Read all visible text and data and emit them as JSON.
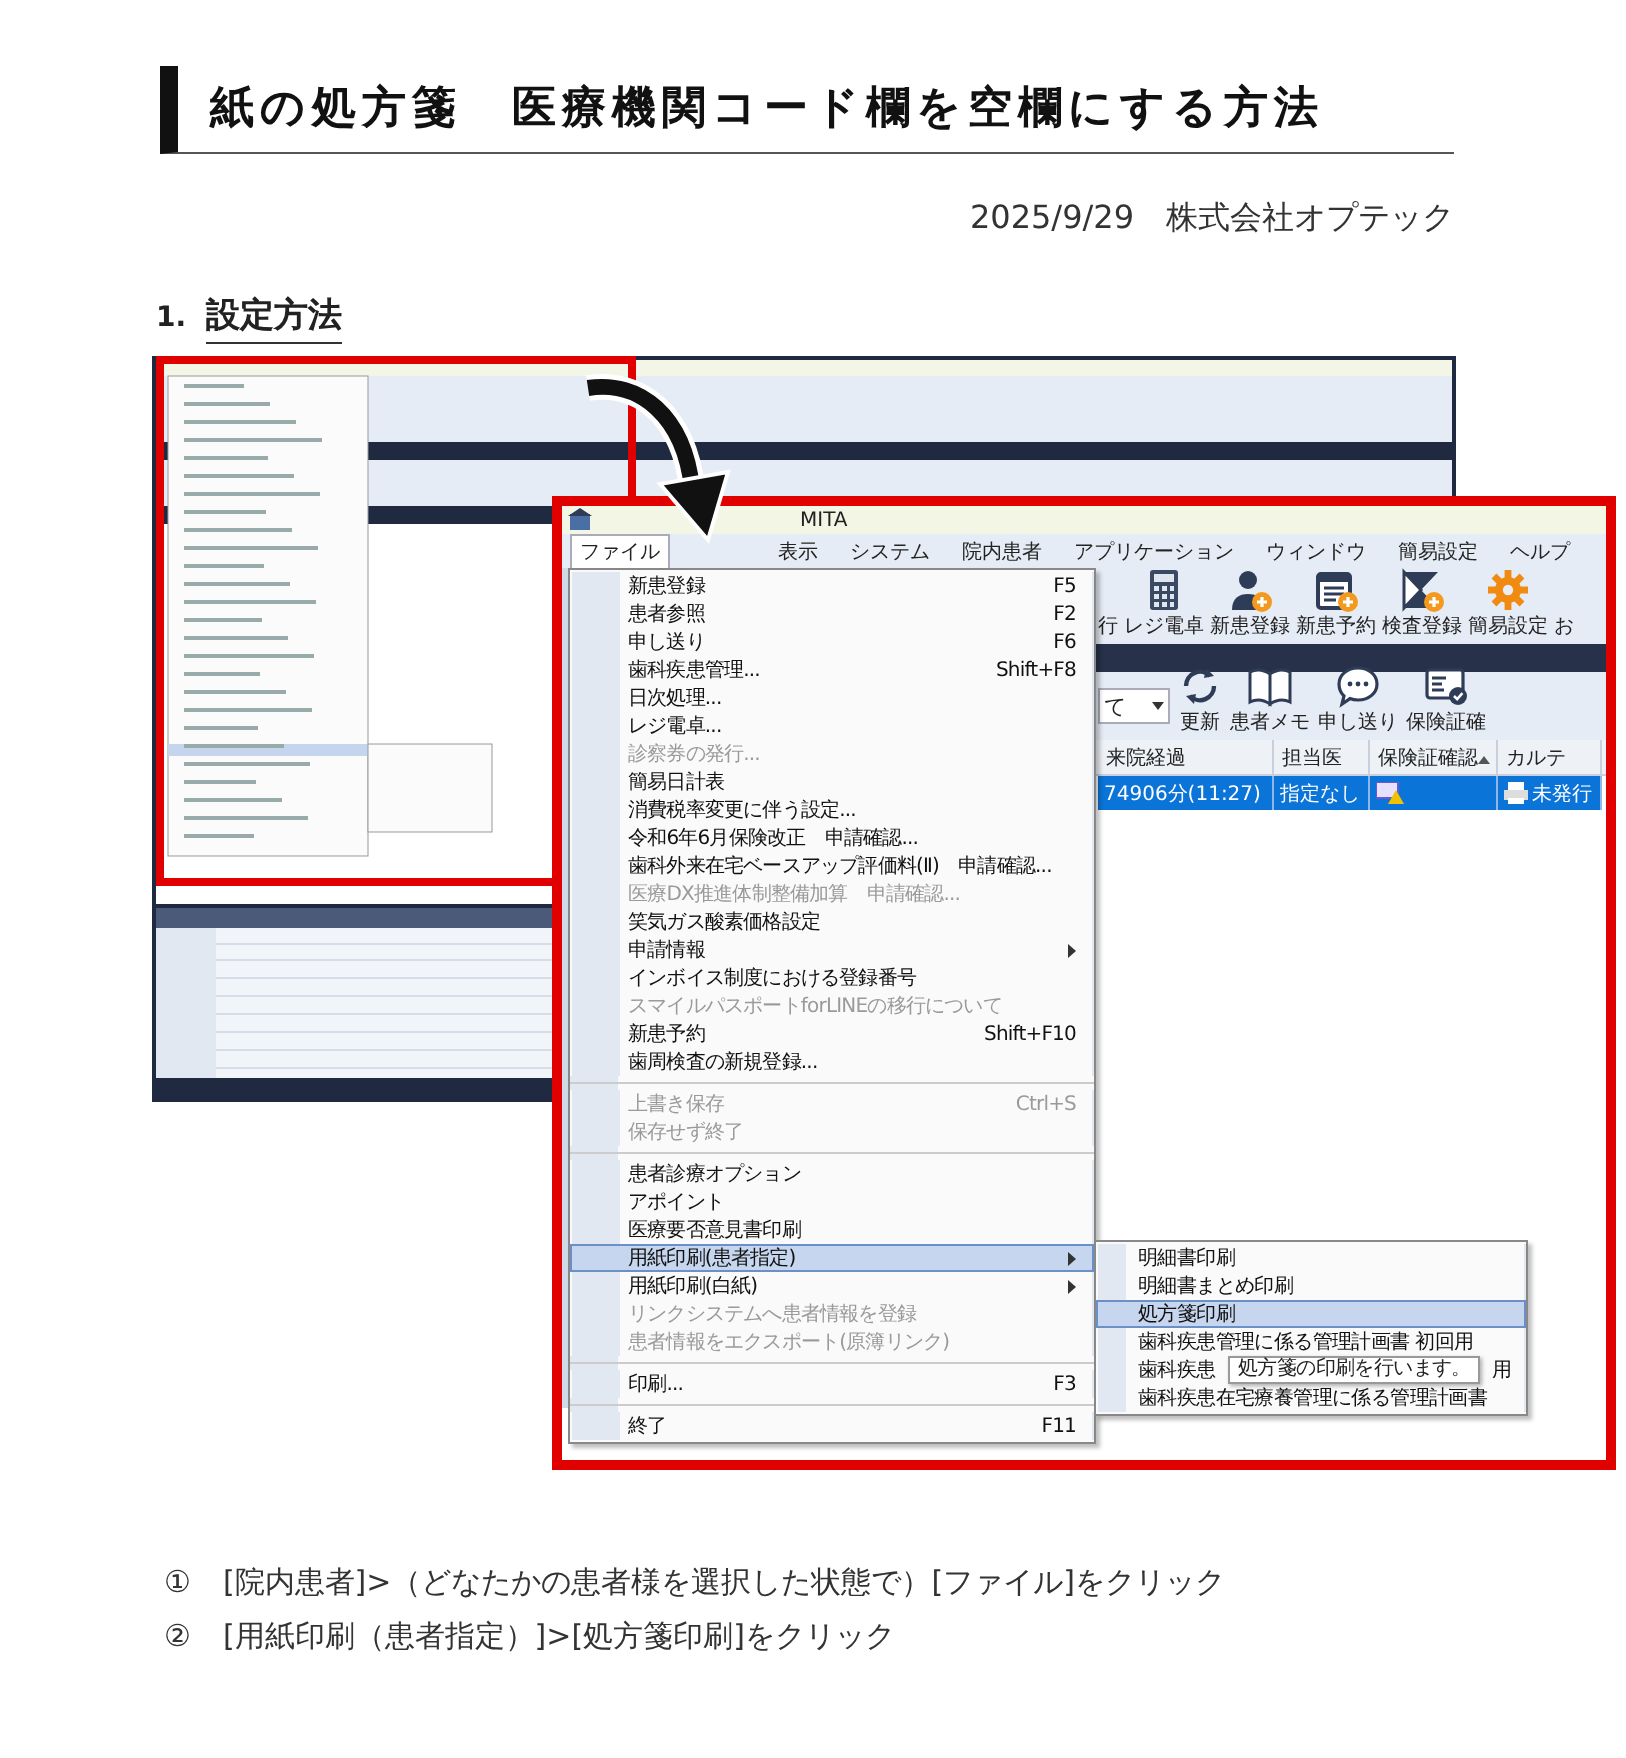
{
  "header": {
    "title": "紙の処方箋　医療機関コード欄を空欄にする方法",
    "date": "2025/9/29",
    "author": "株式会社オプテック"
  },
  "section": {
    "number": "1.",
    "title": "設定方法"
  },
  "screenshot": {
    "title": "MITA",
    "menubar": [
      {
        "label": "ファイル",
        "selected": true
      },
      {
        "label": "表示",
        "selected": false
      },
      {
        "label": "システム",
        "selected": false
      },
      {
        "label": "院内患者",
        "selected": false
      },
      {
        "label": "アプリケーション",
        "selected": false
      },
      {
        "label": "ウィンドウ",
        "selected": false
      },
      {
        "label": "簡易設定",
        "selected": false
      },
      {
        "label": "ヘルプ",
        "selected": false
      }
    ],
    "toolbar": [
      {
        "label": "行"
      },
      {
        "label": "レジ電卓"
      },
      {
        "label": "新患登録"
      },
      {
        "label": "新患予約"
      },
      {
        "label": "検査登録"
      },
      {
        "label": "簡易設定"
      },
      {
        "label": "お"
      }
    ],
    "search": {
      "value": "て"
    },
    "tools": [
      {
        "label": "更新"
      },
      {
        "label": "患者メモ"
      },
      {
        "label": "申し送り"
      },
      {
        "label": "保険証確"
      }
    ],
    "table": {
      "columns": [
        {
          "label": "来院経過",
          "sorted": false
        },
        {
          "label": "担当医",
          "sorted": false
        },
        {
          "label": "保険証確認",
          "sorted": true
        },
        {
          "label": "カルテ",
          "sorted": false
        }
      ],
      "rows": [
        {
          "elapsed": "74906分(11:27)",
          "doctor": "指定なし",
          "chart": "未発行",
          "selected": true
        }
      ]
    },
    "menu": [
      {
        "kind": "item",
        "label": "新患登録",
        "shortcut": "F5",
        "disabled": false,
        "selected": false,
        "has_submenu": false
      },
      {
        "kind": "item",
        "label": "患者参照",
        "shortcut": "F2",
        "disabled": false,
        "selected": false,
        "has_submenu": false
      },
      {
        "kind": "item",
        "label": "申し送り",
        "shortcut": "F6",
        "disabled": false,
        "selected": false,
        "has_submenu": false
      },
      {
        "kind": "item",
        "label": "歯科疾患管理...",
        "shortcut": "Shift+F8",
        "disabled": false,
        "selected": false,
        "has_submenu": false
      },
      {
        "kind": "item",
        "label": "日次処理...",
        "disabled": false,
        "selected": false,
        "has_submenu": false
      },
      {
        "kind": "item",
        "label": "レジ電卓...",
        "disabled": false,
        "selected": false,
        "has_submenu": false
      },
      {
        "kind": "item",
        "label": "診察券の発行...",
        "disabled": true,
        "selected": false,
        "has_submenu": false
      },
      {
        "kind": "item",
        "label": "簡易日計表",
        "disabled": false,
        "selected": false,
        "has_submenu": false
      },
      {
        "kind": "item",
        "label": "消費税率変更に伴う設定...",
        "disabled": false,
        "selected": false,
        "has_submenu": false
      },
      {
        "kind": "item",
        "label": "令和6年6月保険改正　申請確認...",
        "disabled": false,
        "selected": false,
        "has_submenu": false
      },
      {
        "kind": "item",
        "label": "歯科外来在宅ベースアップ評価料(Ⅱ)　申請確認...",
        "disabled": false,
        "selected": false,
        "has_submenu": false
      },
      {
        "kind": "item",
        "label": "医療DX推進体制整備加算　申請確認...",
        "disabled": true,
        "selected": false,
        "has_submenu": false
      },
      {
        "kind": "item",
        "label": "笑気ガス酸素価格設定",
        "disabled": false,
        "selected": false,
        "has_submenu": false
      },
      {
        "kind": "item",
        "label": "申請情報",
        "disabled": false,
        "selected": false,
        "has_submenu": true
      },
      {
        "kind": "item",
        "label": "インボイス制度における登録番号",
        "disabled": false,
        "selected": false,
        "has_submenu": false
      },
      {
        "kind": "item",
        "label": "スマイルパスポートforLINEの移行について",
        "disabled": true,
        "selected": false,
        "has_submenu": false
      },
      {
        "kind": "item",
        "label": "新患予約",
        "shortcut": "Shift+F10",
        "disabled": false,
        "selected": false,
        "has_submenu": false
      },
      {
        "kind": "item",
        "label": "歯周検査の新規登録...",
        "disabled": false,
        "selected": false,
        "has_submenu": false
      },
      {
        "kind": "separator"
      },
      {
        "kind": "item",
        "label": "上書き保存",
        "shortcut": "Ctrl+S",
        "disabled": true,
        "selected": false,
        "has_submenu": false
      },
      {
        "kind": "item",
        "label": "保存せず終了",
        "disabled": true,
        "selected": false,
        "has_submenu": false
      },
      {
        "kind": "separator"
      },
      {
        "kind": "item",
        "label": "患者診療オプション",
        "disabled": false,
        "selected": false,
        "has_submenu": false
      },
      {
        "kind": "item",
        "label": "アポイント",
        "disabled": false,
        "selected": false,
        "has_submenu": false
      },
      {
        "kind": "item",
        "label": "医療要否意見書印刷",
        "disabled": false,
        "selected": false,
        "has_submenu": false
      },
      {
        "kind": "item",
        "label": "用紙印刷(患者指定)",
        "disabled": false,
        "selected": true,
        "has_submenu": true
      },
      {
        "kind": "item",
        "label": "用紙印刷(白紙)",
        "disabled": false,
        "selected": false,
        "has_submenu": true
      },
      {
        "kind": "item",
        "label": "リンクシステムへ患者情報を登録",
        "disabled": true,
        "selected": false,
        "has_submenu": false
      },
      {
        "kind": "item",
        "label": "患者情報をエクスポート(原簿リンク)",
        "disabled": true,
        "selected": false,
        "has_submenu": false
      },
      {
        "kind": "separator"
      },
      {
        "kind": "item",
        "label": "印刷...",
        "shortcut": "F3",
        "disabled": false,
        "selected": false,
        "has_submenu": false
      },
      {
        "kind": "separator"
      },
      {
        "kind": "item",
        "label": "終了",
        "shortcut": "F11",
        "disabled": false,
        "selected": false,
        "has_submenu": false
      }
    ],
    "submenu": [
      {
        "label": "明細書印刷",
        "selected": false
      },
      {
        "label": "明細書まとめ印刷",
        "selected": false
      },
      {
        "label": "処方箋印刷",
        "selected": true
      },
      {
        "label": "歯科疾患管理に係る管理計画書 初回用",
        "selected": false
      },
      {
        "label": "歯科疾患",
        "tail": "用",
        "selected": false
      },
      {
        "label": "歯科疾患在宅療養管理に係る管理計画書",
        "selected": false
      }
    ],
    "tooltip": "処方箋の印刷を行います。"
  },
  "steps": [
    {
      "number": "①",
      "text": "[院内患者]>（どなたかの患者様を選択した状態で）[ファイル]をクリック"
    },
    {
      "number": "②",
      "text": "[用紙印刷（患者指定）]>[処方箋印刷]をクリック"
    }
  ]
}
